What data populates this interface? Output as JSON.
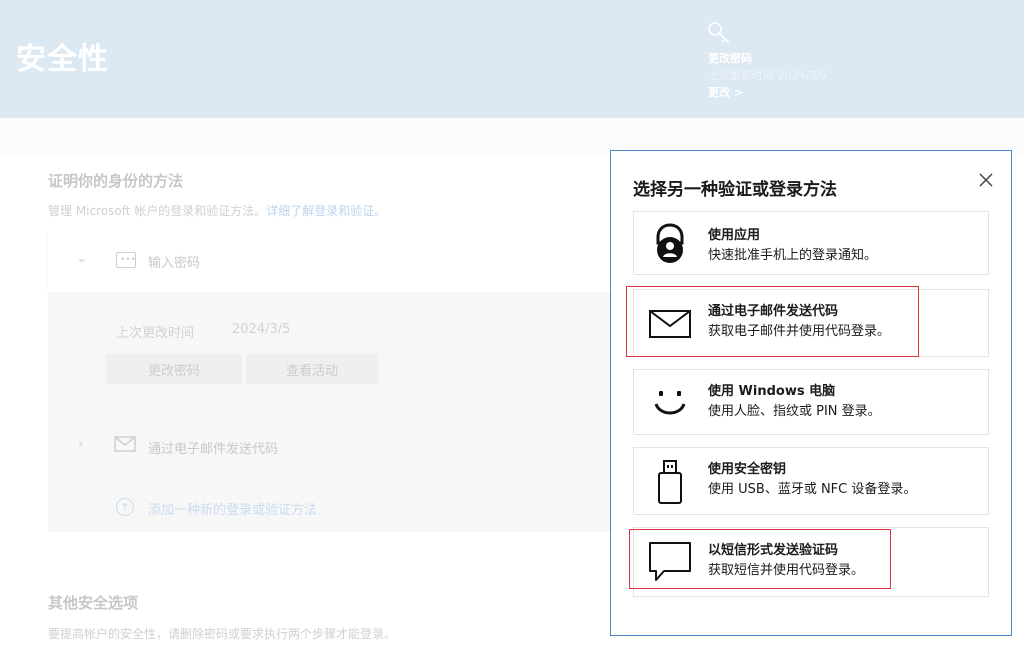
{
  "header": {
    "title": "安全性",
    "password_panel": {
      "title": "更改密码",
      "subtitle": "上次更新时间 2024/3/5",
      "link": "更改 >"
    }
  },
  "methods": {
    "title": "证明你的身份的方法",
    "description": "管理 Microsoft 帐户的登录和验证方法。",
    "learn_more": "详细了解登录和验证。",
    "items": [
      {
        "label": "输入密码",
        "expanded": true
      },
      {
        "label": "通过电子邮件发送代码",
        "expanded": false
      }
    ],
    "last_changed_label": "上次更改时间",
    "last_changed_value": "2024/3/5",
    "change_password_button": "更改密码",
    "view_activity_button": "查看活动",
    "add_method": "添加一种新的登录或验证方法"
  },
  "other_options": {
    "title": "其他安全选项",
    "description": "要提高帐户的安全性，请删除密码或要求执行两个步骤才能登录。"
  },
  "dialog": {
    "title": "选择另一种验证或登录方法",
    "close_icon": "close-icon",
    "options": [
      {
        "icon": "authenticator-app-icon",
        "title": "使用应用",
        "description": "快速批准手机上的登录通知。",
        "highlighted": false
      },
      {
        "icon": "envelope-icon",
        "title": "通过电子邮件发送代码",
        "description": "获取电子邮件并使用代码登录。",
        "highlighted": true
      },
      {
        "icon": "smiley-face-icon",
        "title": "使用 Windows 电脑",
        "description": "使用人脸、指纹或 PIN 登录。",
        "highlighted": false
      },
      {
        "icon": "usb-key-icon",
        "title": "使用安全密钥",
        "description": "使用 USB、蓝牙或 NFC 设备登录。",
        "highlighted": false
      },
      {
        "icon": "chat-bubble-icon",
        "title": "以短信形式发送验证码",
        "description": "获取短信并使用代码登录。",
        "highlighted": true
      }
    ]
  },
  "colors": {
    "banner": "#dce8f2",
    "dialog_border": "#4a88c7",
    "highlight": "#d9363e",
    "link": "#bcd4ec"
  }
}
